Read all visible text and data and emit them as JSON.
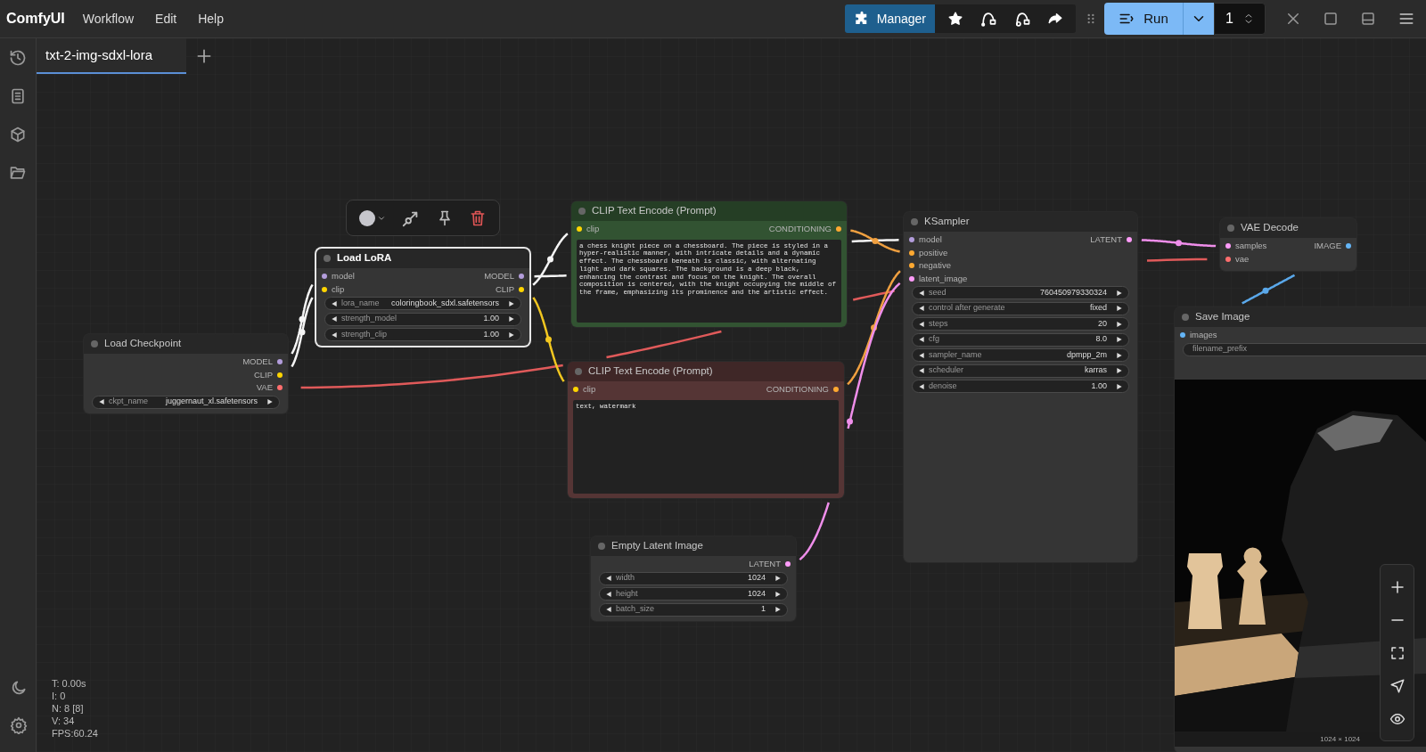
{
  "app_title": "ComfyUI",
  "menu": [
    "Workflow",
    "Edit",
    "Help"
  ],
  "toolbar": {
    "manager": "Manager",
    "run": "Run",
    "batch_count": "1"
  },
  "tabs": [
    {
      "label": "txt-2-img-sdxl-lora",
      "selected": true
    }
  ],
  "nodes": [
    {
      "title": "Load Checkpoint",
      "color": "#353535",
      "selected": false,
      "outputs": [
        {
          "name": "MODEL",
          "color": "#b39ddb"
        },
        {
          "name": "CLIP",
          "color": "#ffd500"
        },
        {
          "name": "VAE",
          "color": "#ff6e6e"
        }
      ],
      "widgets": [
        {
          "kind": "combo",
          "name": "ckpt_name",
          "value": "juggernaut_xl.safetensors"
        }
      ]
    },
    {
      "title": "Load LoRA",
      "color": "#353535",
      "selected": true,
      "inputs": [
        {
          "name": "model",
          "color": "#b39ddb"
        },
        {
          "name": "clip",
          "color": "#ffd500"
        }
      ],
      "outputs": [
        {
          "name": "MODEL",
          "color": "#b39ddb"
        },
        {
          "name": "CLIP",
          "color": "#ffd500"
        }
      ],
      "widgets": [
        {
          "kind": "combo",
          "name": "lora_name",
          "value": "coloringbook_sdxl.safetensors"
        },
        {
          "kind": "number",
          "name": "strength_model",
          "value": "1.00"
        },
        {
          "kind": "number",
          "name": "strength_clip",
          "value": "1.00"
        }
      ]
    },
    {
      "title": "CLIP Text Encode (Prompt)",
      "color": "#325332",
      "selected": false,
      "inputs": [
        {
          "name": "clip",
          "color": "#ffd500"
        }
      ],
      "outputs": [
        {
          "name": "CONDITIONING",
          "color": "#ffa931"
        }
      ],
      "prompt": "a chess knight piece on a chessboard. The piece is styled in a hyper-realistic manner, with intricate details and a dynamic effect. The chessboard beneath is classic, with alternating light and dark squares. The background is a deep black, enhancing the contrast and focus on the knight. The overall composition is centered, with the knight occupying the middle of the frame, emphasizing its prominence and the artistic effect."
    },
    {
      "title": "CLIP Text Encode (Prompt)",
      "color": "#553535",
      "selected": false,
      "inputs": [
        {
          "name": "clip",
          "color": "#ffd500"
        }
      ],
      "outputs": [
        {
          "name": "CONDITIONING",
          "color": "#ffa931"
        }
      ],
      "prompt": "text, watermark"
    },
    {
      "title": "Empty Latent Image",
      "color": "#353535",
      "selected": false,
      "outputs": [
        {
          "name": "LATENT",
          "color": "#ff9cf9"
        }
      ],
      "widgets": [
        {
          "kind": "number",
          "name": "width",
          "value": "1024"
        },
        {
          "kind": "number",
          "name": "height",
          "value": "1024"
        },
        {
          "kind": "number",
          "name": "batch_size",
          "value": "1"
        }
      ]
    },
    {
      "title": "KSampler",
      "color": "#353535",
      "selected": false,
      "inputs": [
        {
          "name": "model",
          "color": "#b39ddb"
        },
        {
          "name": "positive",
          "color": "#ffa931"
        },
        {
          "name": "negative",
          "color": "#ffa931"
        },
        {
          "name": "latent_image",
          "color": "#ff9cf9"
        }
      ],
      "outputs": [
        {
          "name": "LATENT",
          "color": "#ff9cf9"
        }
      ],
      "widgets": [
        {
          "kind": "number",
          "name": "seed",
          "value": "760450979330324"
        },
        {
          "kind": "combo",
          "name": "control after generate",
          "value": "fixed"
        },
        {
          "kind": "number",
          "name": "steps",
          "value": "20"
        },
        {
          "kind": "number",
          "name": "cfg",
          "value": "8.0"
        },
        {
          "kind": "combo",
          "name": "sampler_name",
          "value": "dpmpp_2m"
        },
        {
          "kind": "combo",
          "name": "scheduler",
          "value": "karras"
        },
        {
          "kind": "number",
          "name": "denoise",
          "value": "1.00"
        }
      ]
    },
    {
      "title": "VAE Decode",
      "color": "#353535",
      "selected": false,
      "inputs": [
        {
          "name": "samples",
          "color": "#ff9cf9"
        },
        {
          "name": "vae",
          "color": "#ff6e6e"
        }
      ],
      "outputs": [
        {
          "name": "IMAGE",
          "color": "#64b5f6"
        }
      ]
    },
    {
      "title": "Save Image",
      "color": "#353535",
      "selected": false,
      "inputs": [
        {
          "name": "images",
          "color": "#64b5f6"
        }
      ],
      "widgets": [
        {
          "kind": "text",
          "name": "filename_prefix"
        }
      ],
      "image": {
        "kind": "picture",
        "size": "1024 × 1024"
      }
    }
  ],
  "stats": [
    "T: 0.00s",
    "I: 0",
    "N: 8 [8]",
    "V: 34",
    "FPS:60.24"
  ]
}
